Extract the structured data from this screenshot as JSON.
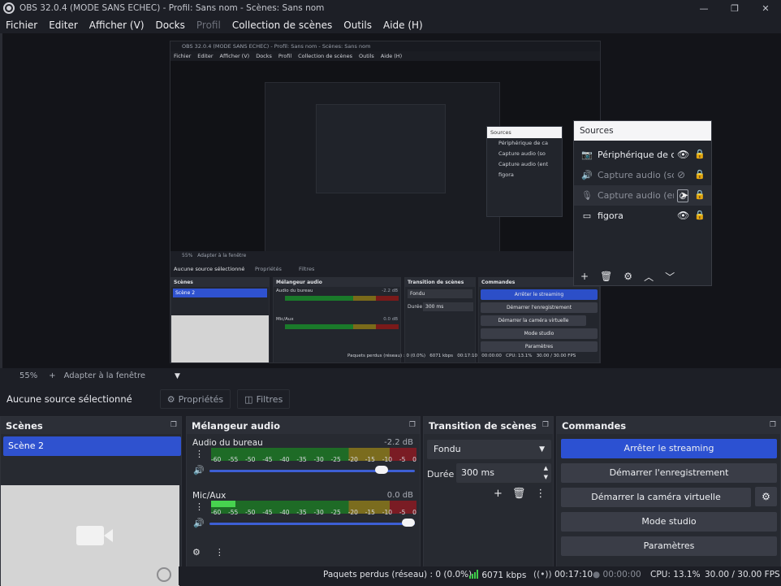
{
  "window": {
    "title": "OBS 32.0.4 (MODE SANS ECHEC) - Profil: Sans nom - Scènes: Sans nom",
    "minimize_glyph": "—",
    "maximize_glyph": "❐",
    "close_glyph": "✕"
  },
  "menu": {
    "items": [
      "Fichier",
      "Editer",
      "Afficher (V)",
      "Docks",
      "Profil",
      "Collection de scènes",
      "Outils",
      "Aide (H)"
    ]
  },
  "preview_capture": {
    "title": "OBS 32.0.4 (MODE SANS ECHEC) - Profil: Sans nom - Scènes: Sans nom",
    "menu": [
      "Fichier",
      "Editer",
      "Afficher (V)",
      "Docks",
      "Profil",
      "Collection de scènes",
      "Outils",
      "Aide (H)"
    ],
    "sources_header": "Sources",
    "sources": [
      "Périphérique de ca",
      "Capture audio (so",
      "Capture audio (ent",
      "figora"
    ],
    "zoom": "55%",
    "fit": "Adapter à la fenêtre",
    "no_source": "Aucune source sélectionné",
    "properties": "Propriétés",
    "filters": "Filtres",
    "scenes_header": "Scènes",
    "scene": "Scène 2",
    "mixer_header": "Mélangeur audio",
    "ch1": "Audio du bureau",
    "ch1_db": "-2.2 dB",
    "ch2": "Mic/Aux",
    "ch2_db": "0.0 dB",
    "transition_header": "Transition de scènes",
    "transition": "Fondu",
    "duration_label": "Durée",
    "duration": "300 ms",
    "commands_header": "Commandes",
    "commands": [
      "Arrêter le streaming",
      "Démarrer l'enregistrement",
      "Démarrer la caméra virtuelle",
      "Mode studio",
      "Paramètres"
    ],
    "status": "Paquets perdus (réseau) : 0 (0.0%)",
    "kbps": "6071 kbps",
    "time": "00:17:10",
    "rec": "00:00:00",
    "cpu": "CPU: 13.1%",
    "fps": "30.00 / 30.00 FPS"
  },
  "sources_dock": {
    "title": "Sources",
    "items": [
      {
        "icon": "camera-icon",
        "glyph": "📷",
        "label": "Périphérique de ca",
        "visible": true
      },
      {
        "icon": "speaker-icon",
        "glyph": "🔊",
        "label": "Capture audio (sor",
        "visible": false
      },
      {
        "icon": "microphone-icon",
        "glyph": "🎙",
        "label": "Capture audio (ent",
        "visible": false
      },
      {
        "icon": "monitor-icon",
        "glyph": "▭",
        "label": "figora",
        "visible": true
      }
    ],
    "toolbar": [
      "+",
      "🗑",
      "⚙",
      "︿",
      "﹀"
    ]
  },
  "zoom": {
    "level": "55%",
    "plus": "+",
    "fit_label": "Adapter à la fenêtre"
  },
  "source_toolbar": {
    "no_selection": "Aucune source sélectionné",
    "properties": "Propriétés",
    "filters": "Filtres"
  },
  "scenes": {
    "title": "Scènes",
    "items": [
      "Scène 2"
    ]
  },
  "mixer": {
    "title": "Mélangeur audio",
    "ticks": [
      "-60",
      "-55",
      "-50",
      "-45",
      "-40",
      "-35",
      "-30",
      "-25",
      "-20",
      "-15",
      "-10",
      "-5",
      "0"
    ],
    "channels": [
      {
        "name": "Audio du bureau",
        "db": "-2.2 dB",
        "level": 0.0,
        "volume": 0.87
      },
      {
        "name": "Mic/Aux",
        "db": "0.0 dB",
        "level": 0.12,
        "volume": 1.0
      }
    ]
  },
  "transition": {
    "title": "Transition de scènes",
    "selected": "Fondu",
    "duration_label": "Durée",
    "duration_value": "300 ms"
  },
  "commands": {
    "title": "Commandes",
    "stop_streaming": "Arrêter le streaming",
    "start_recording": "Démarrer l'enregistrement",
    "start_virtualcam": "Démarrer la caméra virtuelle",
    "studio_mode": "Mode studio",
    "settings": "Paramètres"
  },
  "status": {
    "dropped": "Paquets perdus (réseau) : 0 (0.0%)",
    "bitrate": "6071 kbps",
    "stream_time": "00:17:10",
    "rec_time": "00:00:00",
    "cpu": "CPU: 13.1%",
    "fps": "30.00 / 30.00 FPS"
  },
  "colors": {
    "accent": "#2c51d2",
    "meter_green": "#1e6b26",
    "meter_yellow": "#7b6c1e",
    "meter_red": "#7a1c24",
    "live_green": "#3fce4a"
  }
}
